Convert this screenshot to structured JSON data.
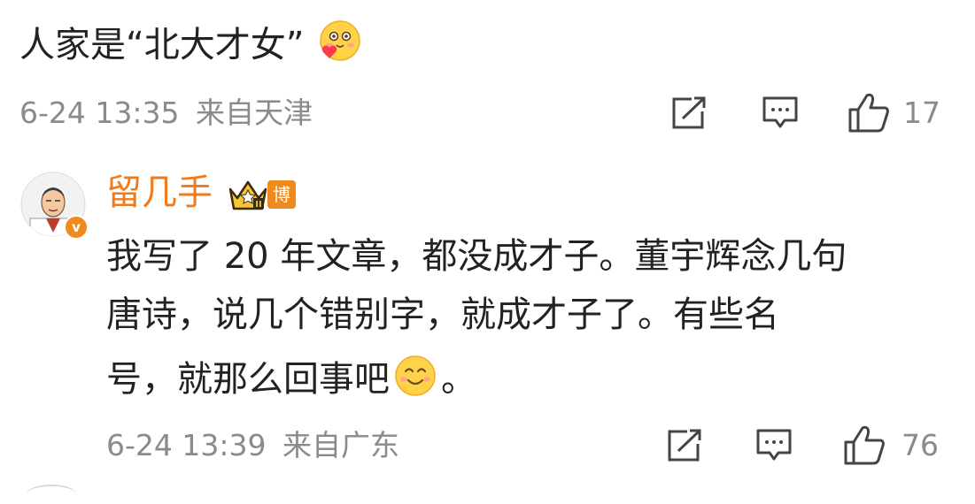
{
  "parent_comment": {
    "text": "人家是“北大才女”",
    "emoji": "cute-blush-emoji",
    "date": "6-24 13:35",
    "location": "来自天津",
    "like_count": "17"
  },
  "reply": {
    "username": "留几手",
    "role_badge": "博主",
    "level_badge": "crown-level-badge",
    "verified_badge": "v",
    "text_lines": [
      "我写了 20 年文章，都没成才子。董宇辉念几句",
      "唐诗，说几个错别字，就成才子了。有些名",
      "号，就那么回事吧"
    ],
    "text_end": "。",
    "emoji": "smile-emoji",
    "date": "6-24 13:39",
    "location": "来自广东",
    "like_count": "76"
  },
  "colors": {
    "username": "#f07b1d",
    "meta": "#8a8a8a",
    "badge_orange": "#f08a1c",
    "text": "#222222"
  }
}
